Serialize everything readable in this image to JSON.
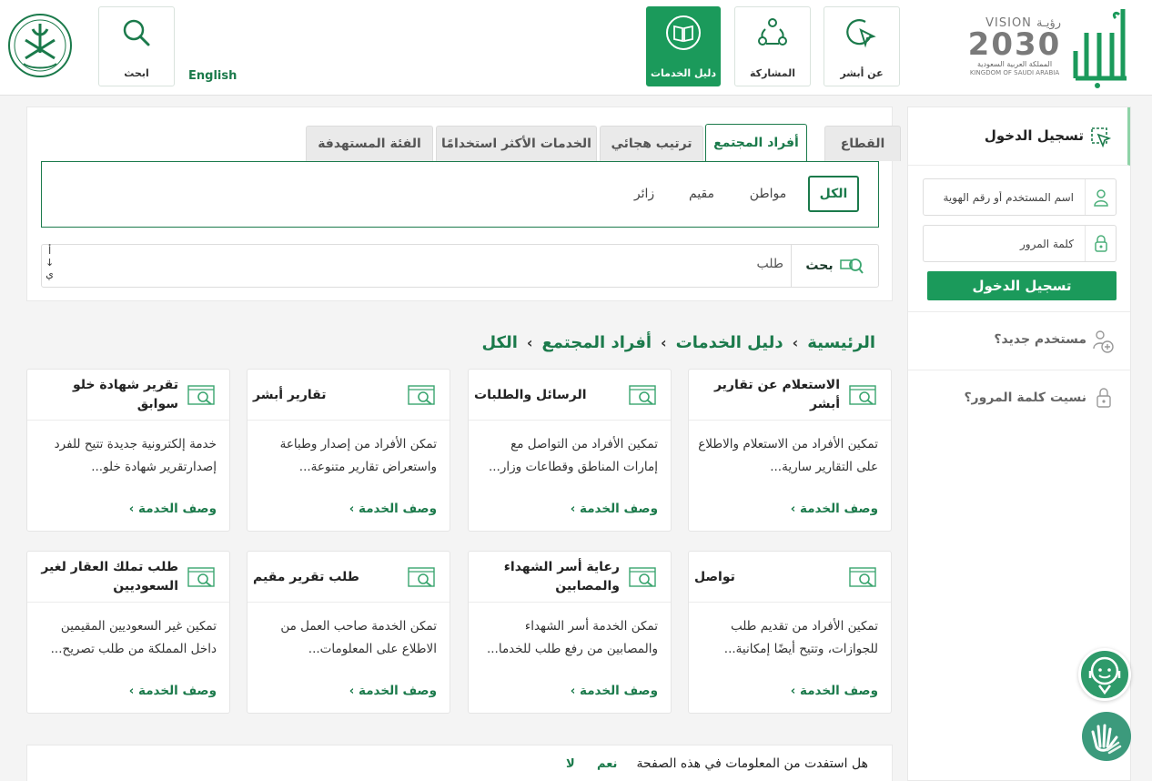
{
  "header": {
    "nav": [
      {
        "label": "عن أبشر",
        "icon": "pointer-icon"
      },
      {
        "label": "المشاركة",
        "icon": "share-icon"
      },
      {
        "label": "دليل الخدمات",
        "icon": "book-icon",
        "active": true
      }
    ],
    "search_label": "ابحث",
    "language": "English",
    "vision": {
      "line1": "VISION رؤيـة",
      "line2": "2030",
      "line3": "المملكة العربية السعودية",
      "line4": "KINGDOM OF SAUDI ARABIA"
    },
    "logo": "أبشر"
  },
  "filters": {
    "tabs": [
      "القطاع",
      "أفراد المجتمع",
      "ترتيب هجائي",
      "الخدمات الأكثر استخدامًا",
      "الفئة المستهدفة"
    ],
    "active_tab": "أفراد المجتمع",
    "chips": [
      "الكل",
      "مواطن",
      "مقيم",
      "زائر"
    ],
    "active_chip": "الكل",
    "search_button": "بحث",
    "search_query": "طلب",
    "sort_top": "أ",
    "sort_arrow": "↓",
    "sort_bottom": "ي"
  },
  "breadcrumb": [
    "الرئيسية",
    "دليل الخدمات",
    "أفراد المجتمع",
    "الكل"
  ],
  "breadcrumb_sep": "›",
  "services": [
    {
      "title": "الاستعلام عن تقارير أبشر",
      "desc": "تمكين الأفراد من الاستعلام والاطلاع على التقارير سارية...",
      "link": "وصف الخدمة ›"
    },
    {
      "title": "الرسائل والطلبات",
      "desc": "تمكين الأفراد من التواصل مع إمارات المناطق وقطاعات وزار...",
      "link": "وصف الخدمة ›"
    },
    {
      "title": "تقارير أبشر",
      "desc": "تمكن الأفراد من إصدار وطباعة واستعراض تقارير متنوعة...",
      "link": "وصف الخدمة ›"
    },
    {
      "title": "تقرير شهادة خلو سوابق",
      "desc": "خدمة إلكترونية جديدة تتيح للفرد إصدارتقرير شهادة خلو...",
      "link": "وصف الخدمة ›"
    },
    {
      "title": "تواصل",
      "desc": "تمكين الأفراد من تقديم طلب للجوازات، وتتيح أيضًا إمكانية...",
      "link": "وصف الخدمة ›"
    },
    {
      "title": "رعاية أسر الشهداء والمصابين",
      "desc": "تمكن الخدمة أسر الشهداء والمصابين من رفع طلب للخدما...",
      "link": "وصف الخدمة ›"
    },
    {
      "title": "طلب تقرير مقيم",
      "desc": "تمكن الخدمة صاحب العمل من الاطلاع على المعلومات...",
      "link": "وصف الخدمة ›"
    },
    {
      "title": "طلب تملك العقار لغير السعوديين",
      "desc": "تمكين غير السعوديين المقيمين داخل المملكة من طلب تصريح...",
      "link": "وصف الخدمة ›"
    }
  ],
  "feedback": {
    "question": "هل استفدت من المعلومات في هذه الصفحة",
    "yes": "نعم",
    "no": "لا"
  },
  "login": {
    "title": "تسجيل الدخول",
    "username_placeholder": "اسم المستخدم أو رقم الهوية",
    "password_placeholder": "كلمة المرور",
    "button": "تسجيل الدخول",
    "new_user": "مستخدم جديد؟",
    "forgot": "نسيت كلمة المرور؟"
  },
  "colors": {
    "primary": "#1b7a4b",
    "button": "#1b9a5b",
    "chat": "#2e9a6a",
    "accessibility": "#3c9a7c"
  }
}
